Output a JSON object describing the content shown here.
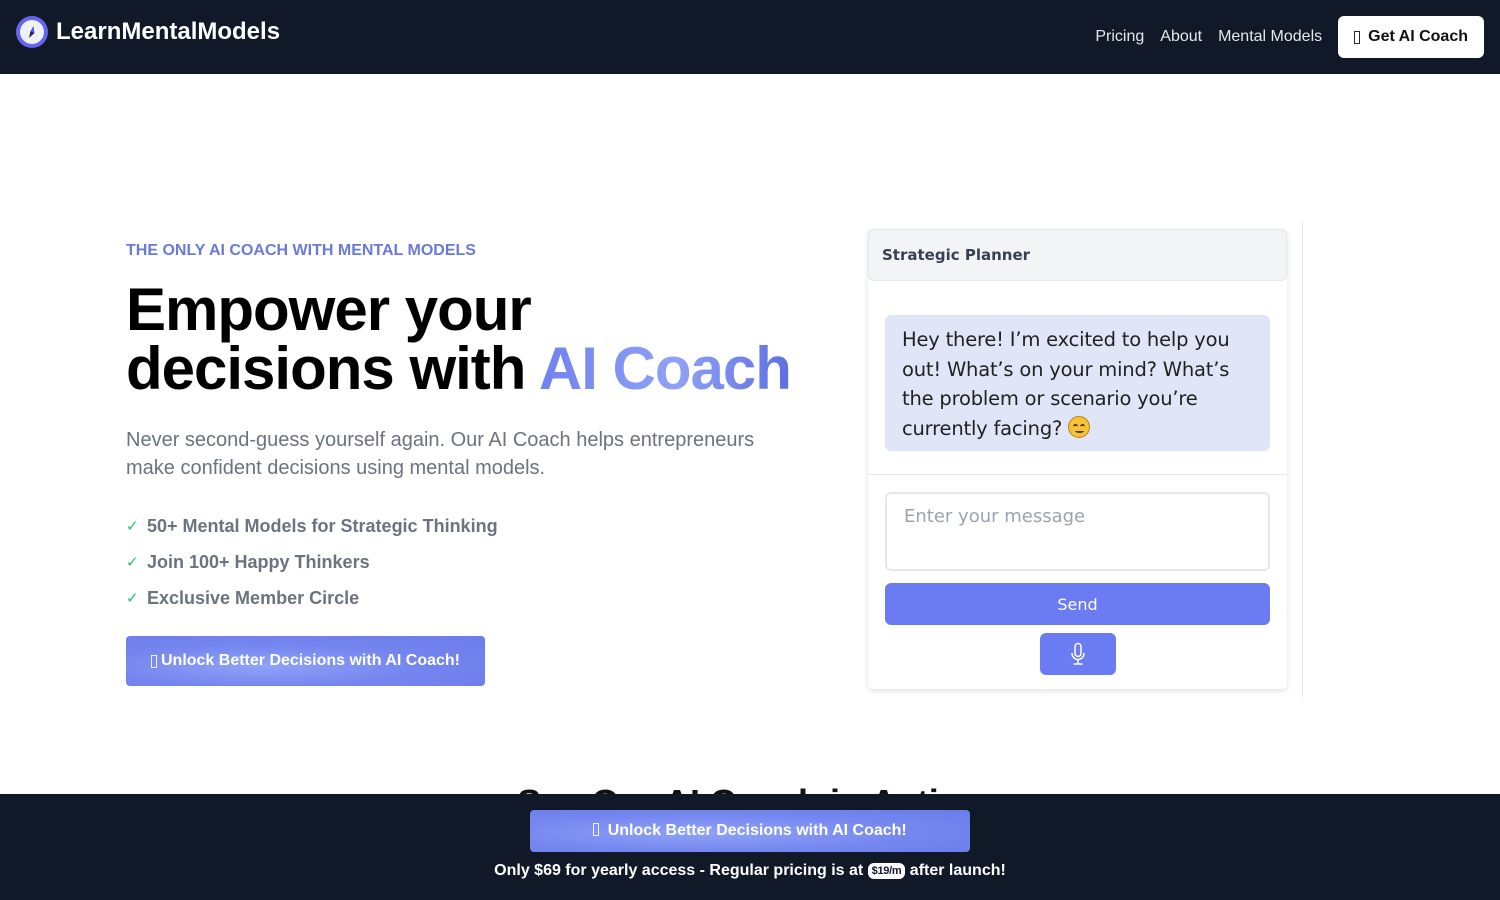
{
  "nav": {
    "brand": "LearnMentalModels",
    "logo_icon": "compass-icon",
    "links": [
      {
        "label": "Pricing"
      },
      {
        "label": "About"
      },
      {
        "label": "Mental Models"
      }
    ],
    "cta_label": "Get AI Coach",
    "cta_icon": "missing-glyph-icon"
  },
  "hero": {
    "eyebrow": "THE ONLY AI COACH WITH MENTAL MODELS",
    "headline_line1": "Empower your",
    "headline_line2_prefix": "decisions with ",
    "headline_accent": "AI Coach",
    "subtitle": "Never second-guess yourself again. Our AI Coach helps entrepreneurs make confident decisions using mental models.",
    "features": [
      {
        "icon": "check-icon",
        "text": "50+ Mental Models for Strategic Thinking"
      },
      {
        "icon": "check-icon",
        "text": "Join 100+ Happy Thinkers"
      },
      {
        "icon": "check-icon",
        "text": "Exclusive Member Circle"
      }
    ],
    "cta_label": "Unlock Better Decisions with AI Coach!"
  },
  "chat": {
    "title": "Strategic Planner",
    "message": "Hey there! I’m excited to help you out! What’s on your mind? What’s the problem or scenario you’re currently facing?",
    "message_emoji": "smiling-face-emoji",
    "input_value": "",
    "input_placeholder": "Enter your message",
    "send_label": "Send",
    "mic_icon": "microphone-icon"
  },
  "section": {
    "title": "See Our AI Coach in Action"
  },
  "bottom_bar": {
    "cta_label": "Unlock Better Decisions with AI Coach!",
    "pricing_prefix": "Only $69 for yearly access - Regular pricing is at ",
    "pricing_pill": "$19/m",
    "pricing_suffix": " after launch!"
  },
  "colors": {
    "nav_bg": "#111827",
    "accent": "#6b7cf2",
    "eyebrow": "#6b7ad8",
    "check": "#22c55e",
    "bubble_bg": "#e0e5f7"
  }
}
